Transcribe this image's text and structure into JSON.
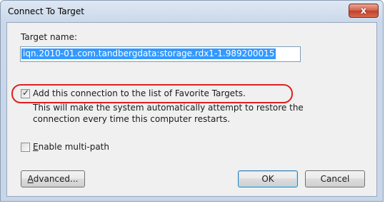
{
  "dialog": {
    "title": "Connect To Target",
    "close_label": "x"
  },
  "target": {
    "label": "Target name:",
    "value": "iqn.2010-01.com.tandbergdata:storage.rdx1-1.989200015"
  },
  "favorite": {
    "checked": true,
    "label": "Add this connection to the list of Favorite Targets.",
    "description": "This will make the system automatically attempt to restore the connection every time this computer restarts."
  },
  "multipath": {
    "checked": false,
    "label_accel": "E",
    "label_rest": "nable multi-path"
  },
  "buttons": {
    "advanced_accel": "A",
    "advanced_rest": "dvanced...",
    "ok": "OK",
    "cancel": "Cancel"
  },
  "colors": {
    "highlight_ring": "#e02020",
    "selection": "#3399ff"
  }
}
